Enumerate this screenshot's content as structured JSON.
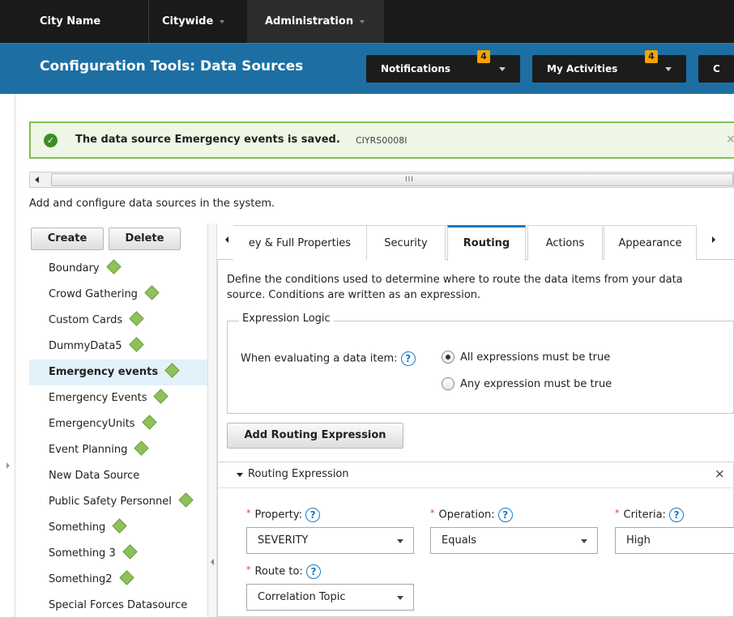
{
  "topnav": {
    "city_name": "City Name",
    "citywide": "Citywide",
    "administration": "Administration"
  },
  "header": {
    "title": "Configuration Tools: Data Sources",
    "notifications_label": "Notifications",
    "notifications_count": "4",
    "activities_label": "My Activities",
    "activities_count": "4",
    "overflow_label": "C"
  },
  "notice": {
    "message": "The data source Emergency events is saved.",
    "code": "CIYRS0008I",
    "close": "×"
  },
  "scroll": {
    "grip": "III"
  },
  "description": "Add and configure data sources in the system.",
  "sidebar": {
    "create_label": "Create",
    "delete_label": "Delete",
    "items": [
      {
        "label": "Boundary",
        "status": true
      },
      {
        "label": "Crowd Gathering",
        "status": true
      },
      {
        "label": "Custom Cards",
        "status": true
      },
      {
        "label": "DummyData5",
        "status": true
      },
      {
        "label": "Emergency events",
        "status": true,
        "selected": true
      },
      {
        "label": "Emergency Events",
        "status": true
      },
      {
        "label": "EmergencyUnits",
        "status": true
      },
      {
        "label": "Event Planning",
        "status": true
      },
      {
        "label": "New Data Source",
        "status": false
      },
      {
        "label": "Public Safety Personnel",
        "status": true
      },
      {
        "label": "Something",
        "status": true
      },
      {
        "label": "Something 3",
        "status": true
      },
      {
        "label": "Something2",
        "status": true
      },
      {
        "label": "Special Forces Datasource",
        "status": false
      }
    ]
  },
  "tabs": {
    "items": [
      "ey & Full Properties",
      "Security",
      "Routing",
      "Actions",
      "Appearance"
    ],
    "active": "Routing"
  },
  "routing": {
    "description": "Define the conditions used to determine where to route the data items from your data source. Conditions are written as an expression.",
    "logic_legend": "Expression Logic",
    "evaluate_label": "When evaluating a data item:",
    "help": "?",
    "option_all": "All expressions must be true",
    "option_any": "Any expression must be true",
    "add_button": "Add Routing Expression",
    "expression": {
      "title": "Routing Expression",
      "close": "×",
      "required_mark": "*",
      "property_label": "Property:",
      "property_value": "SEVERITY",
      "operation_label": "Operation:",
      "operation_value": "Equals",
      "criteria_label": "Criteria:",
      "criteria_value": "High",
      "route_label": "Route to:",
      "route_value": "Correlation Topic"
    }
  },
  "colors": {
    "nav_bg": "#1a1a1a",
    "header_blue": "#1d6fa3",
    "badge": "#f5a300",
    "success_border": "#82bf56",
    "active_tab": "#1a78c2",
    "status_diamond": "#8ec15c"
  },
  "icons": {
    "check": "check-circle-icon",
    "help": "help-circle-icon",
    "status": "status-diamond-icon"
  }
}
